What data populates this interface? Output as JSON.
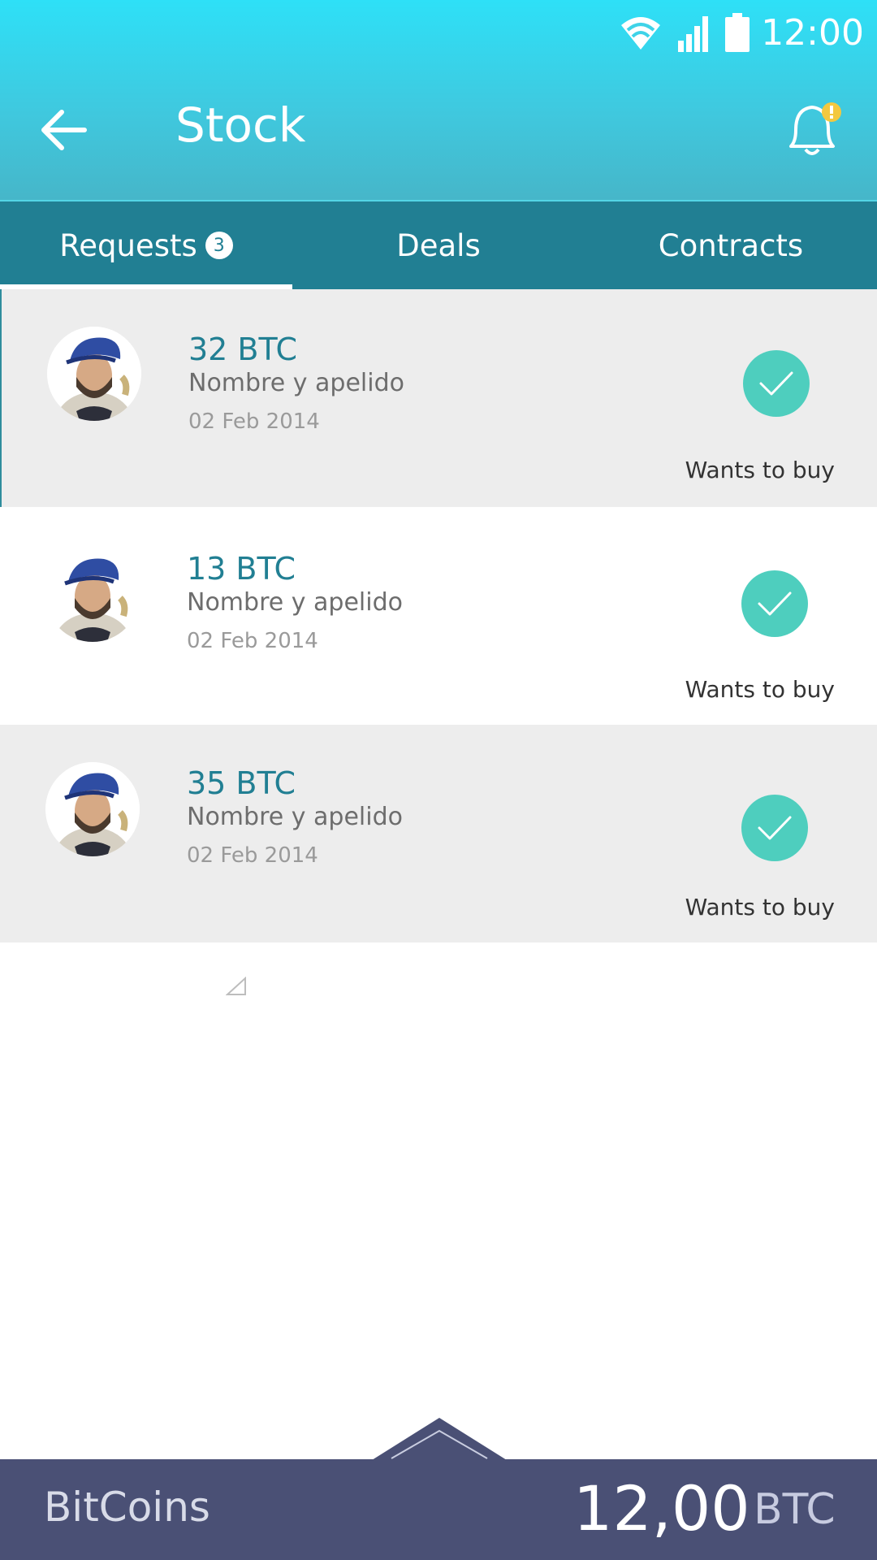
{
  "status": {
    "time": "12:00"
  },
  "header": {
    "title": "Stock"
  },
  "tabs": [
    {
      "label": "Requests",
      "badge": "3"
    },
    {
      "label": "Deals"
    },
    {
      "label": "Contracts"
    }
  ],
  "requests": [
    {
      "amount": "32 BTC",
      "name": "Nombre y apelido",
      "date": "02 Feb 2014",
      "status": "Wants to buy"
    },
    {
      "amount": "13 BTC",
      "name": "Nombre y apelido",
      "date": "02 Feb 2014",
      "status": "Wants to buy"
    },
    {
      "amount": "35 BTC",
      "name": "Nombre y apelido",
      "date": "02 Feb 2014",
      "status": "Wants to buy"
    }
  ],
  "footer": {
    "label": "BitCoins",
    "value": "12,00",
    "unit": "BTC"
  },
  "colors": {
    "header_top": "#2ee0f7",
    "tabs_bg": "#217f93",
    "accent_check": "#4ecebe",
    "footer_bg": "#4a5075",
    "notification_dot": "#f3c83f"
  }
}
